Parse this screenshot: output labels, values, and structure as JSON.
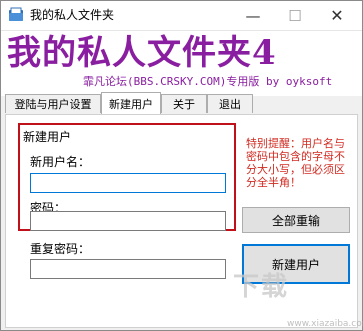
{
  "window": {
    "title": "我的私人文件夹",
    "minimize": "—",
    "maximize": "☐",
    "close": "✕"
  },
  "header": {
    "big_title": "我的私人文件夹4",
    "subtitle": "霏凡论坛(BBS.CRSKY.COM)专用版 by oyksoft",
    "title_color": "#8a1ea0"
  },
  "tabs": [
    {
      "label": "登陆与用户设置",
      "active": false
    },
    {
      "label": "新建用户",
      "active": true
    },
    {
      "label": "关于",
      "active": false
    },
    {
      "label": "退出",
      "active": false
    }
  ],
  "new_user": {
    "group_title": "新建用户",
    "username_label": "新用户名：",
    "username_value": "",
    "password_label": "密码：",
    "password_value": "",
    "confirm_label": "重复密码：",
    "confirm_value": ""
  },
  "warning": "特别提醒：用户名与密码中包含的字母不分大小写，但必须区分全半角！",
  "buttons": {
    "reset": "全部重输",
    "create": "新建用户"
  },
  "watermark": {
    "text": "下载",
    "url": "www.xiazaiba.com"
  },
  "colors": {
    "accent_red": "#c0101a",
    "warning_text": "#d02a20",
    "focus_blue": "#0078d7"
  }
}
